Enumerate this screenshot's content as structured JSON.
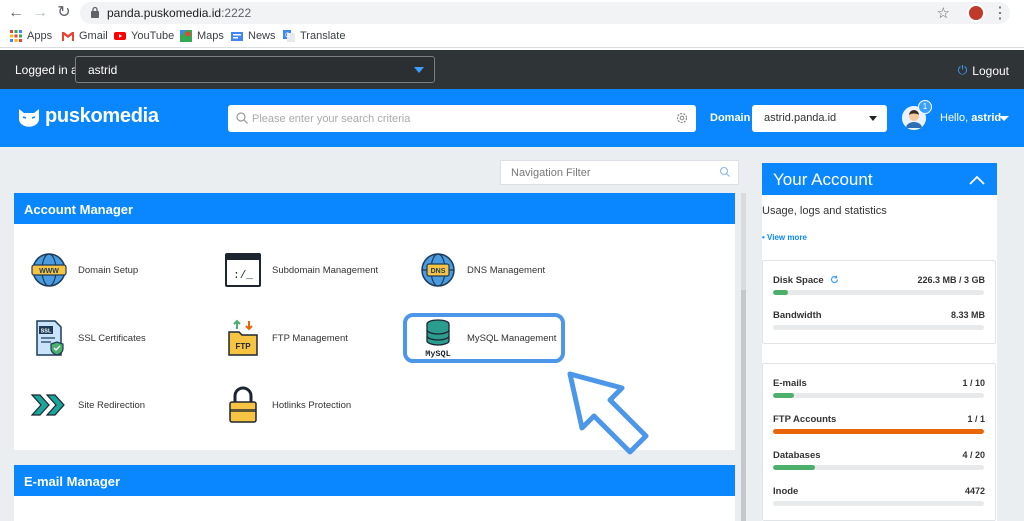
{
  "browser": {
    "url_host": "panda.puskomedia.id",
    "url_port": ":2222",
    "bookmarks": [
      "Apps",
      "Gmail",
      "YouTube",
      "Maps",
      "News",
      "Translate"
    ]
  },
  "topbar": {
    "logged_in_label": "Logged in as",
    "user": "astrid",
    "logout_label": "Logout"
  },
  "header": {
    "brand": "puskomedia",
    "search_placeholder": "Please enter your search criteria",
    "domain_label": "Domain",
    "domain_value": "astrid.panda.id",
    "notifications": "1",
    "hello_prefix": "Hello,",
    "hello_name": "astrid"
  },
  "nav_filter": {
    "placeholder": "Navigation Filter"
  },
  "account_manager": {
    "title": "Account Manager",
    "items": [
      {
        "label": "Domain Setup",
        "icon": "www-globe-icon"
      },
      {
        "label": "Subdomain Management",
        "icon": "terminal-window-icon"
      },
      {
        "label": "DNS Management",
        "icon": "dns-globe-icon"
      },
      {
        "label": "SSL Certificates",
        "icon": "ssl-certificate-icon"
      },
      {
        "label": "FTP Management",
        "icon": "ftp-folder-icon"
      },
      {
        "label": "MySQL Management",
        "icon": "mysql-database-icon"
      },
      {
        "label": "Site Redirection",
        "icon": "redirect-arrows-icon"
      },
      {
        "label": "Hotlinks Protection",
        "icon": "padlock-icon"
      }
    ]
  },
  "email_manager": {
    "title": "E-mail Manager"
  },
  "your_account": {
    "title": "Your Account",
    "subtitle": "Usage, logs and statistics",
    "view_more": "• View more",
    "usage": [
      {
        "label": "Disk Space",
        "value": "226.3 MB / 3 GB",
        "fraction": 0.07,
        "color": "#4caf6a"
      },
      {
        "label": "Bandwidth",
        "value": "8.33 MB",
        "fraction": 0,
        "color": "#4caf6a"
      }
    ],
    "limits": [
      {
        "label": "E-mails",
        "value": "1 / 10",
        "fraction": 0.1,
        "color": "#4caf6a"
      },
      {
        "label": "FTP Accounts",
        "value": "1 / 1",
        "fraction": 1.0,
        "color": "#e8650a"
      },
      {
        "label": "Databases",
        "value": "4 / 20",
        "fraction": 0.2,
        "color": "#4caf6a"
      },
      {
        "label": "Inode",
        "value": "4472",
        "fraction": 0,
        "color": "#4caf6a"
      }
    ]
  },
  "colors": {
    "brand_blue": "#0a87ff",
    "dark_bar": "#2f3436",
    "highlight": "#4d97ea"
  }
}
